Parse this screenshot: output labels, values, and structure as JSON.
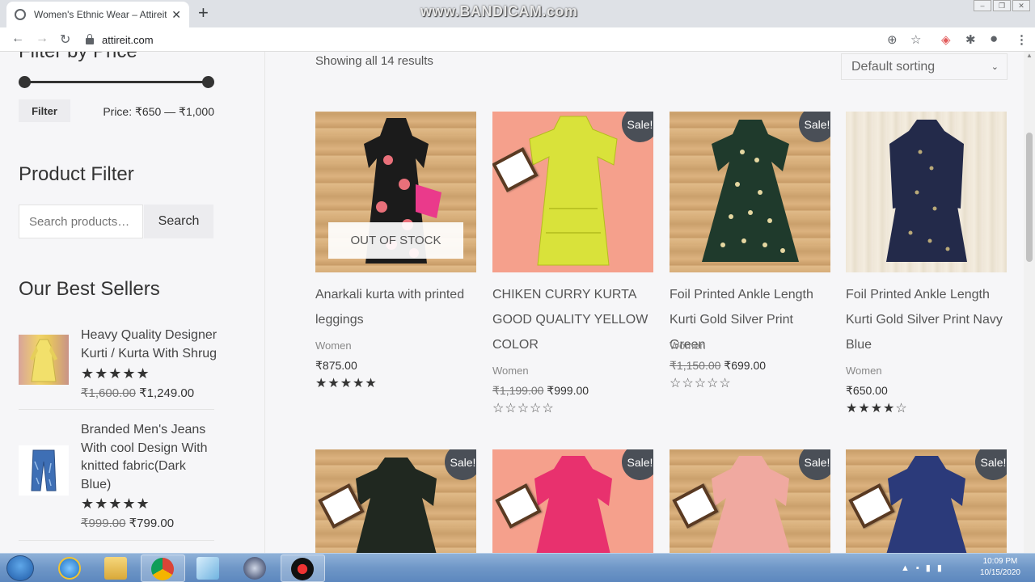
{
  "browser": {
    "tab_title": "Women's Ethnic Wear – Attireit.C",
    "url": "attireit.com",
    "watermark": "www.BANDICAM.com"
  },
  "sidebar": {
    "filter_price_title": "Filter by Price",
    "filter_button": "Filter",
    "price_label": "Price:",
    "price_min": "₹650",
    "price_sep": "—",
    "price_max": "₹1,000",
    "product_filter_title": "Product Filter",
    "search_placeholder": "Search products…",
    "search_button": "Search",
    "best_sellers_title": "Our Best Sellers",
    "best_sellers": [
      {
        "name": "Heavy Quality Designer Kurti / Kurta With Shrug",
        "rating": 5,
        "old_price": "₹1,600.00",
        "price": "₹1,249.00"
      },
      {
        "name": "Branded Men's Jeans With cool Design With knitted fabric(Dark Blue)",
        "rating": 5,
        "old_price": "₹999.00",
        "price": "₹799.00"
      }
    ]
  },
  "shop": {
    "results_text": "Showing all 14 results",
    "sort_selected": "Default sorting",
    "sale_badge": "Sale!",
    "out_of_stock": "OUT OF STOCK",
    "products": [
      {
        "name": "Anarkali kurta with printed leggings",
        "category": "Women",
        "old_price": "",
        "price": "₹875.00",
        "rating": 5,
        "sale": false,
        "out_of_stock": true
      },
      {
        "name": "CHIKEN CURRY KURTA GOOD QUALITY YELLOW COLOR",
        "category": "Women",
        "old_price": "₹1,199.00",
        "price": "₹999.00",
        "rating": 0,
        "sale": true,
        "out_of_stock": false
      },
      {
        "name": "Foil Printed Ankle Length Kurti Gold Silver Print Green",
        "category": "Women",
        "old_price": "₹1,150.00",
        "price": "₹699.00",
        "rating": 0,
        "sale": true,
        "out_of_stock": false
      },
      {
        "name": "Foil Printed Ankle Length Kurti Gold Silver Print Navy Blue",
        "category": "Women",
        "old_price": "",
        "price": "₹650.00",
        "rating": 4,
        "sale": false,
        "out_of_stock": false
      }
    ]
  },
  "taskbar": {
    "time": "10:09 PM",
    "date": "10/15/2020"
  },
  "colors": {
    "page_bg": "#f6f6f8",
    "sale_badge": "#4a4f57",
    "taskbar": "#6f97c7"
  }
}
